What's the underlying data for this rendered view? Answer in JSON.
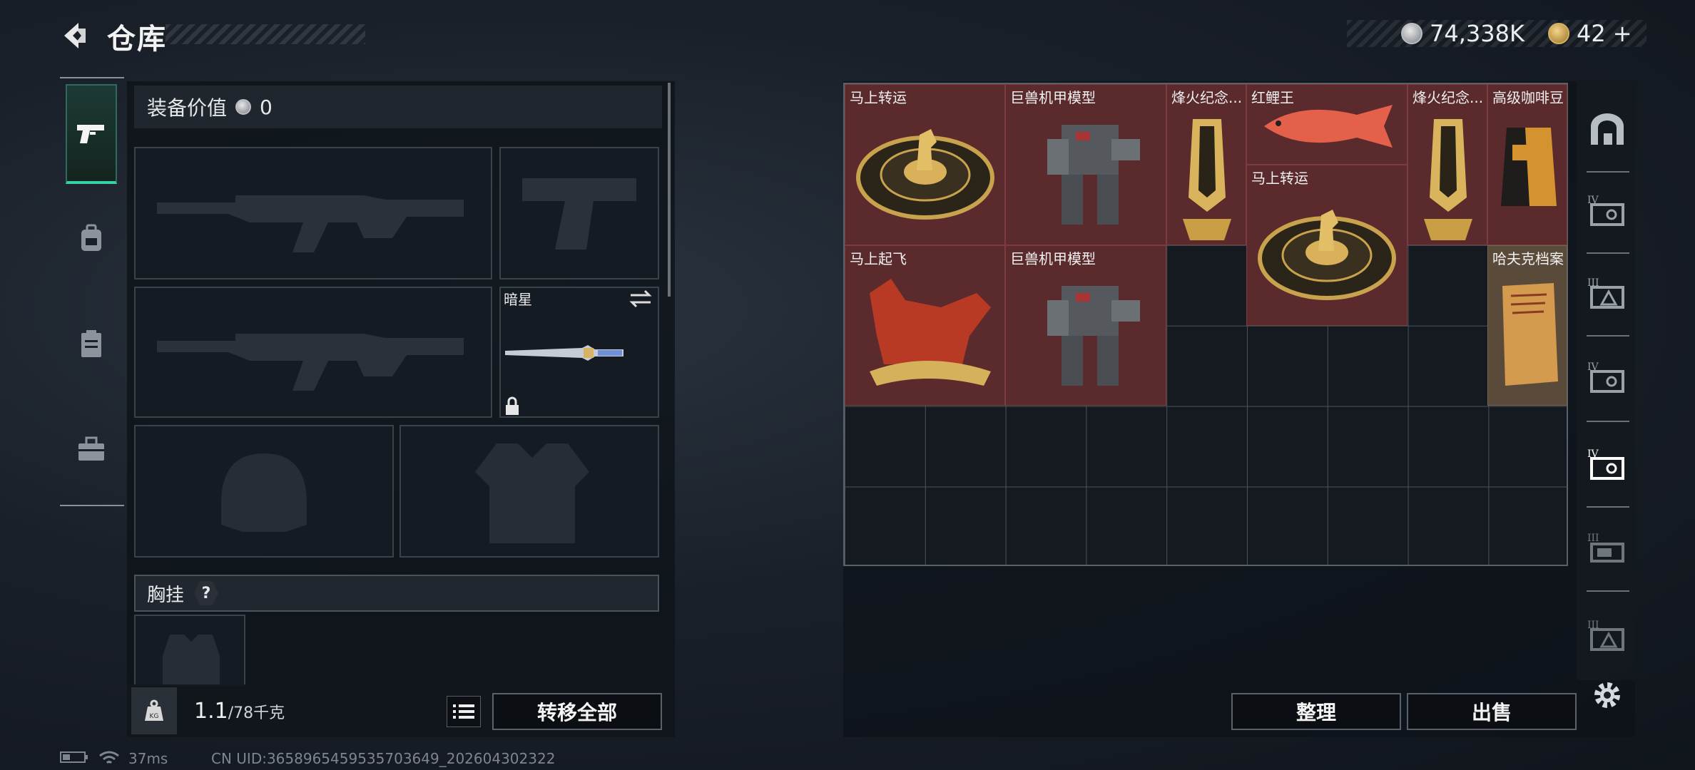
{
  "header": {
    "title": "仓库",
    "silver": "74,338K",
    "gold": "42",
    "gold_plus": "+"
  },
  "left_panel": {
    "value_label": "装备价值",
    "value": "0",
    "knife_name": "暗星",
    "chest_label": "胸挂",
    "chest_help": "?",
    "weight_current": "1.1",
    "weight_max": "/78千克",
    "transfer_all": "转移全部"
  },
  "warehouse": {
    "items": [
      {
        "label": "马上转运",
        "icon": "horse-fortune-disc"
      },
      {
        "label": "巨兽机甲模型",
        "icon": "mech-model"
      },
      {
        "label": "烽火纪念...",
        "icon": "gold-trophy"
      },
      {
        "label": "红鲤王",
        "icon": "red-carp"
      },
      {
        "label": "马上转运",
        "icon": "horse-fortune-disc"
      },
      {
        "label": "烽火纪念...",
        "icon": "gold-trophy"
      },
      {
        "label": "高级咖啡豆",
        "icon": "coffee-bag"
      },
      {
        "label": "马上起飞",
        "icon": "red-horse-statue"
      },
      {
        "label": "巨兽机甲模型",
        "icon": "mech-model"
      },
      {
        "label": "哈夫克档案",
        "icon": "dossier"
      }
    ],
    "sort_button": "整理",
    "sell_button": "出售",
    "tabs": [
      "",
      "IV",
      "III",
      "IV",
      "IV",
      "III",
      "III"
    ]
  },
  "status_bar": {
    "ping": "37ms",
    "uid": "CN UID:3658965459535703649_202604302322"
  }
}
